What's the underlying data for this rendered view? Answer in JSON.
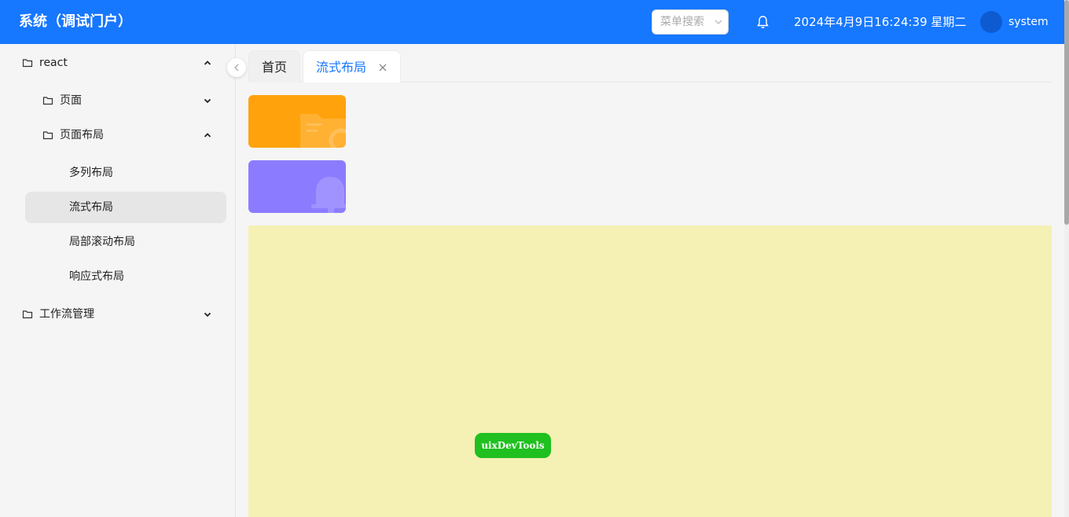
{
  "header": {
    "title": "系统（调试门户）",
    "search_placeholder": "菜单搜索",
    "datetime": "2024年4月9日16:24:39 星期二",
    "username": "system",
    "brand_color": "#1677ff"
  },
  "sidebar": {
    "items": [
      {
        "label": "react",
        "level": 1,
        "expanded": true
      },
      {
        "label": "页面",
        "level": 2,
        "expanded": false
      },
      {
        "label": "页面布局",
        "level": 2,
        "expanded": true
      },
      {
        "label": "多列布局",
        "level": 3
      },
      {
        "label": "流式布局",
        "level": 3,
        "selected": true
      },
      {
        "label": "局部滚动布局",
        "level": 3
      },
      {
        "label": "响应式布局",
        "level": 3
      },
      {
        "label": "工作流管理",
        "level": 1,
        "expanded": false
      }
    ]
  },
  "tabs": [
    {
      "label": "首页",
      "active": false
    },
    {
      "label": "流式布局",
      "active": true
    }
  ],
  "content": {
    "cards": [
      {
        "color": "#ffa20c",
        "icon": "folder-icon"
      },
      {
        "color": "#8b7cff",
        "icon": "bell-icon"
      }
    ],
    "area_color": "#f5f0b3"
  },
  "devtools": {
    "label": "uixDevTools",
    "color": "#1fc01f"
  }
}
